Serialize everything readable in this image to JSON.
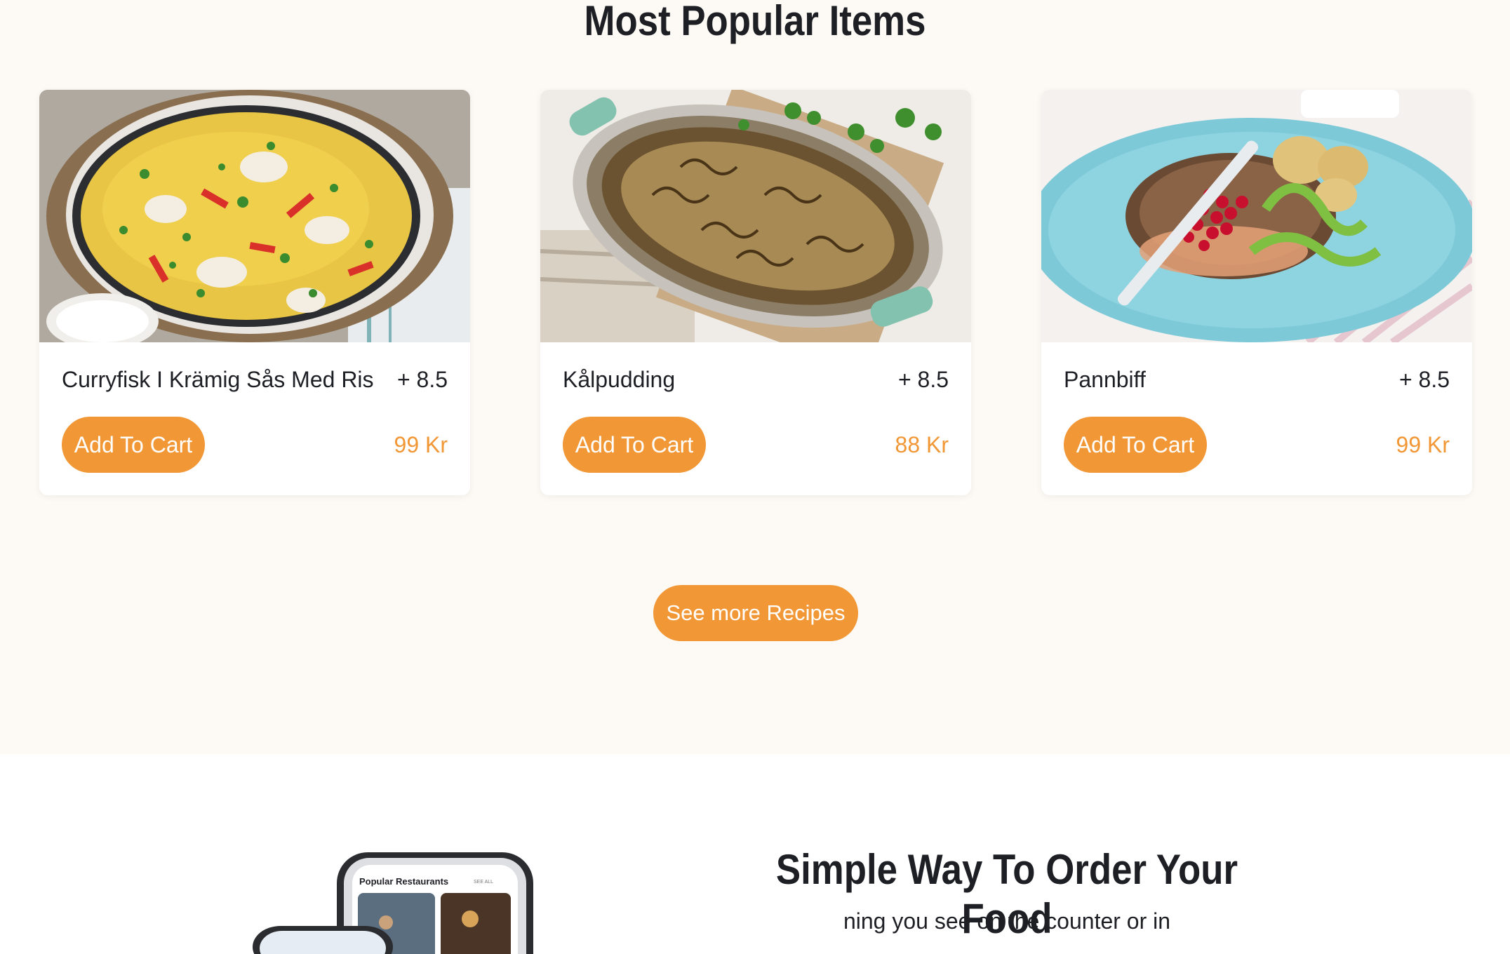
{
  "popular": {
    "title": "Most Popular Items",
    "items": [
      {
        "name": "Curryfisk I Krämig Sås Med Ris",
        "rating": "+ 8.5",
        "button": "Add To Cart",
        "price": "99 Kr",
        "image_icon": "curry-fish-dish-image"
      },
      {
        "name": "Kålpudding",
        "rating": "+ 8.5",
        "button": "Add To Cart",
        "price": "88 Kr",
        "image_icon": "cabbage-pudding-image"
      },
      {
        "name": "Pannbiff",
        "rating": "+ 8.5",
        "button": "Add To Cart",
        "price": "99 Kr",
        "image_icon": "pannbiff-plate-image"
      }
    ],
    "see_more": "See more Recipes"
  },
  "order_section": {
    "title": "Simple Way To Order Your Food",
    "text": "ning you see on the counter or in",
    "phone_screen_title": "Popular Restaurants",
    "phone_screen_link": "SEE ALL"
  },
  "colors": {
    "accent": "#f29735",
    "background": "#fdfaf5",
    "text": "#1d1f24"
  }
}
